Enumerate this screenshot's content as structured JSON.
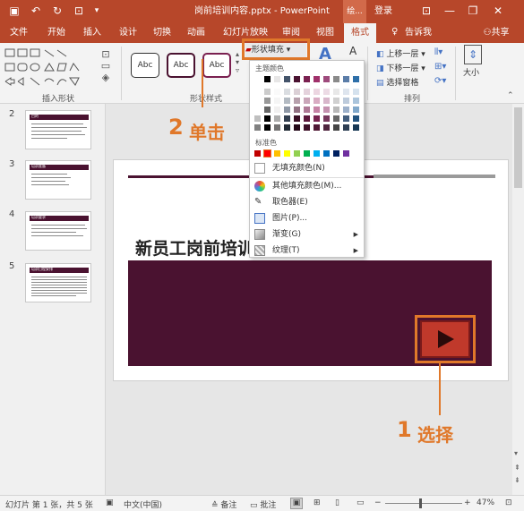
{
  "window": {
    "title": "岗前培训内容.pptx  -  PowerPoint",
    "tell_me": "绘...",
    "login": "登录"
  },
  "tabs": [
    "文件",
    "开始",
    "插入",
    "设计",
    "切换",
    "动画",
    "幻灯片放映",
    "审阅",
    "视图",
    "格式"
  ],
  "tell_me_label": "告诉我",
  "share_label": "共享",
  "ribbon": {
    "insert_shapes_label": "插入形状",
    "shape_styles_label": "形状样式",
    "arrange_label": "排列",
    "style_samples": [
      "Abc",
      "Abc",
      "Abc"
    ],
    "shape_fill_button": "形状填充",
    "bring_forward": "上移一层",
    "send_backward": "下移一层",
    "selection_pane": "选择窗格",
    "size_label": "大小"
  },
  "menu": {
    "theme_colors_label": "主题颜色",
    "standard_colors_label": "标准色",
    "items": [
      "无填充颜色(N)",
      "其他填充颜色(M)...",
      "取色器(E)",
      "图片(P)...",
      "渐变(G)",
      "纹理(T)"
    ],
    "theme_top": [
      "#ffffff",
      "#000000",
      "#e7e6e6",
      "#44546a",
      "#4a1230",
      "#7a2050",
      "#a0306a",
      "#9e4a7c",
      "#8a8a8a",
      "#5b7da8",
      "#2e6fa8"
    ],
    "standard": [
      "#c00000",
      "#ff0000",
      "#ffc000",
      "#ffff00",
      "#92d050",
      "#00b050",
      "#00b0f0",
      "#0070c0",
      "#002060",
      "#7030a0"
    ]
  },
  "thumbs": [
    {
      "num": "2",
      "title": "目的"
    },
    {
      "num": "3",
      "title": "培训准备"
    },
    {
      "num": "4",
      "title": "培训要求"
    },
    {
      "num": "5",
      "title": "培训日程安排"
    }
  ],
  "slide": {
    "title": "新员工岗前培训"
  },
  "annotations": {
    "step2": "2",
    "step2_text": "单击",
    "step1": "1",
    "step1_text": "选择"
  },
  "status": {
    "slide_info": "幻灯片 第 1 张，共 5 张",
    "language": "中文(中国)",
    "notes": "备注",
    "comments": "批注",
    "zoom": "47%"
  }
}
